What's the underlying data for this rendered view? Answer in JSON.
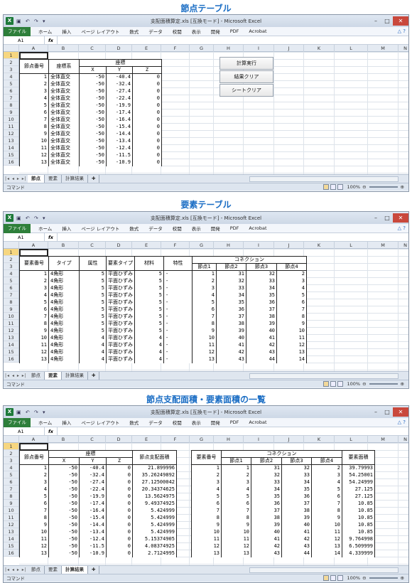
{
  "section_titles": [
    "節点テーブル",
    "要素テーブル",
    "節点支配面積・要素面積の一覧"
  ],
  "window": {
    "title": "支配面積算定.xls [互換モード] - Microsoft Excel",
    "ribbon_tabs": [
      "ファイル",
      "ホーム",
      "挿入",
      "ページ レイアウト",
      "数式",
      "データ",
      "校閲",
      "表示",
      "開発",
      "PDF",
      "Acrobat"
    ],
    "name_box": "A1",
    "fx": "fx",
    "status_left": "コマンド",
    "zoom": "100%",
    "sheet_tabs": [
      "節点",
      "要素",
      "計算結果"
    ]
  },
  "columns": [
    "A",
    "B",
    "C",
    "D",
    "E",
    "F",
    "G",
    "H",
    "I",
    "J",
    "K",
    "L",
    "M",
    "N"
  ],
  "rows": [
    "1",
    "2",
    "3",
    "4",
    "5",
    "6",
    "7",
    "8",
    "9",
    "10",
    "11",
    "12",
    "13",
    "14",
    "15",
    "16"
  ],
  "buttons": {
    "calc": "計算実行",
    "clear_results": "結果クリア",
    "clear_sheet": "シートクリア"
  },
  "node_table": {
    "h_no": "節点番号",
    "h_sys": "座標系",
    "h_coord": "座標",
    "h_x": "X",
    "h_y": "Y",
    "h_z": "Z",
    "rows": [
      [
        "1",
        "全体直交",
        "-50",
        "-40.4",
        "0"
      ],
      [
        "2",
        "全体直交",
        "-50",
        "-32.4",
        "0"
      ],
      [
        "3",
        "全体直交",
        "-50",
        "-27.4",
        "0"
      ],
      [
        "4",
        "全体直交",
        "-50",
        "-22.4",
        "0"
      ],
      [
        "5",
        "全体直交",
        "-50",
        "-19.9",
        "0"
      ],
      [
        "6",
        "全体直交",
        "-50",
        "-17.4",
        "0"
      ],
      [
        "7",
        "全体直交",
        "-50",
        "-16.4",
        "0"
      ],
      [
        "8",
        "全体直交",
        "-50",
        "-15.4",
        "0"
      ],
      [
        "9",
        "全体直交",
        "-50",
        "-14.4",
        "0"
      ],
      [
        "10",
        "全体直交",
        "-50",
        "-13.4",
        "0"
      ],
      [
        "11",
        "全体直交",
        "-50",
        "-12.4",
        "0"
      ],
      [
        "12",
        "全体直交",
        "-50",
        "-11.5",
        "0"
      ],
      [
        "13",
        "全体直交",
        "-50",
        "-10.9",
        "0"
      ]
    ]
  },
  "elem_table": {
    "h_no": "要素番号",
    "h_type": "タイプ",
    "h_attr": "属性",
    "h_etype": "要素タイプ",
    "h_mat": "材料",
    "h_prop": "特性",
    "h_conn": "コネクション",
    "h_n": [
      "節点1",
      "節点2",
      "節点3",
      "節点4"
    ],
    "rows": [
      [
        "1",
        "4角形",
        "5",
        "平面ひずみ",
        "5",
        "-",
        "1",
        "31",
        "32",
        "2"
      ],
      [
        "2",
        "4角形",
        "5",
        "平面ひずみ",
        "5",
        "-",
        "2",
        "32",
        "33",
        "3"
      ],
      [
        "3",
        "4角形",
        "5",
        "平面ひずみ",
        "5",
        "-",
        "3",
        "33",
        "34",
        "4"
      ],
      [
        "4",
        "4角形",
        "5",
        "平面ひずみ",
        "5",
        "-",
        "4",
        "34",
        "35",
        "5"
      ],
      [
        "5",
        "4角形",
        "5",
        "平面ひずみ",
        "5",
        "-",
        "5",
        "35",
        "36",
        "6"
      ],
      [
        "6",
        "4角形",
        "5",
        "平面ひずみ",
        "5",
        "-",
        "6",
        "36",
        "37",
        "7"
      ],
      [
        "7",
        "4角形",
        "5",
        "平面ひずみ",
        "5",
        "-",
        "7",
        "37",
        "38",
        "8"
      ],
      [
        "8",
        "4角形",
        "5",
        "平面ひずみ",
        "5",
        "-",
        "8",
        "38",
        "39",
        "9"
      ],
      [
        "9",
        "4角形",
        "5",
        "平面ひずみ",
        "5",
        "-",
        "9",
        "39",
        "40",
        "10"
      ],
      [
        "10",
        "4角形",
        "4",
        "平面ひずみ",
        "4",
        "-",
        "10",
        "40",
        "41",
        "11"
      ],
      [
        "11",
        "4角形",
        "4",
        "平面ひずみ",
        "4",
        "-",
        "11",
        "41",
        "42",
        "12"
      ],
      [
        "12",
        "4角形",
        "4",
        "平面ひずみ",
        "4",
        "-",
        "12",
        "42",
        "43",
        "13"
      ],
      [
        "13",
        "4角形",
        "4",
        "平面ひずみ",
        "4",
        "-",
        "13",
        "43",
        "44",
        "14"
      ]
    ]
  },
  "result": {
    "h_node_no": "節点番号",
    "h_coord": "座標",
    "h_x": "X",
    "h_y": "Y",
    "h_z": "Z",
    "h_node_area": "節点支配面積",
    "h_elem_no": "要素番号",
    "h_conn": "コネクション",
    "h_n": [
      "節点1",
      "節点2",
      "節点3",
      "節点4"
    ],
    "h_elem_area": "要素面積",
    "node_rows": [
      [
        "1",
        "-50",
        "-40.4",
        "0",
        "21.899996"
      ],
      [
        "2",
        "-50",
        "-32.4",
        "0",
        "35.26249892"
      ],
      [
        "3",
        "-50",
        "-27.4",
        "0",
        "27.12500042"
      ],
      [
        "4",
        "-50",
        "-22.4",
        "0",
        "20.34374625"
      ],
      [
        "5",
        "-50",
        "-19.9",
        "0",
        "13.5624975"
      ],
      [
        "6",
        "-50",
        "-17.4",
        "0",
        "9.49374925"
      ],
      [
        "7",
        "-50",
        "-16.4",
        "0",
        "5.424999"
      ],
      [
        "8",
        "-50",
        "-15.4",
        "0",
        "5.424999"
      ],
      [
        "9",
        "-50",
        "-14.4",
        "0",
        "5.424999"
      ],
      [
        "10",
        "-50",
        "-13.4",
        "0",
        "5.424999"
      ],
      [
        "11",
        "-50",
        "-12.4",
        "0",
        "5.15374905"
      ],
      [
        "12",
        "-50",
        "-11.5",
        "0",
        "4.08374925"
      ],
      [
        "13",
        "-50",
        "-10.9",
        "0",
        "2.7124995"
      ]
    ],
    "elem_rows": [
      [
        "1",
        "1",
        "31",
        "32",
        "2",
        "39.79993"
      ],
      [
        "2",
        "2",
        "32",
        "33",
        "3",
        "54.25001"
      ],
      [
        "3",
        "3",
        "33",
        "34",
        "4",
        "54.24999"
      ],
      [
        "4",
        "4",
        "34",
        "35",
        "5",
        "27.125"
      ],
      [
        "5",
        "5",
        "35",
        "36",
        "6",
        "27.125"
      ],
      [
        "6",
        "6",
        "36",
        "37",
        "7",
        "10.85"
      ],
      [
        "7",
        "7",
        "37",
        "38",
        "8",
        "10.85"
      ],
      [
        "8",
        "8",
        "38",
        "39",
        "9",
        "10.85"
      ],
      [
        "9",
        "9",
        "39",
        "40",
        "10",
        "10.85"
      ],
      [
        "10",
        "10",
        "40",
        "41",
        "11",
        "10.85"
      ],
      [
        "11",
        "11",
        "41",
        "42",
        "12",
        "9.764998"
      ],
      [
        "12",
        "12",
        "42",
        "43",
        "13",
        "6.509999"
      ],
      [
        "13",
        "13",
        "43",
        "44",
        "14",
        "4.339999"
      ]
    ]
  }
}
